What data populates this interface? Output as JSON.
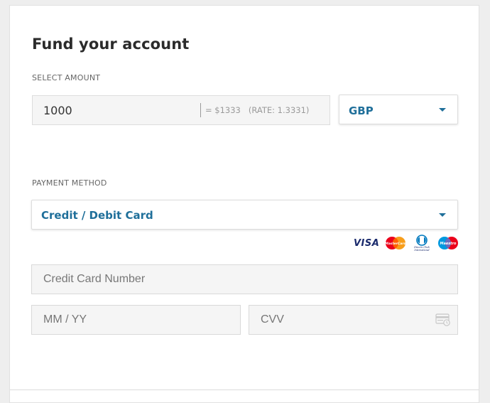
{
  "page": {
    "title": "Fund your account"
  },
  "amount": {
    "section_label": "SELECT AMOUNT",
    "value": "1000",
    "converted": "= $1333",
    "rate": "(RATE: 1.3331)",
    "currency": "GBP"
  },
  "payment": {
    "section_label": "PAYMENT METHOD",
    "method": "Credit / Debit Card",
    "accepted_cards": [
      "VISA",
      "MasterCard",
      "Diners Club International",
      "Maestro"
    ]
  },
  "card_form": {
    "number_placeholder": "Credit Card Number",
    "expiry_placeholder": "MM / YY",
    "cvv_placeholder": "CVV"
  },
  "colors": {
    "accent": "#1f6f9a",
    "visa_blue": "#1a2a6c",
    "mastercard_red": "#eb001b",
    "mastercard_yellow": "#f79e1b",
    "maestro_blue": "#0099df",
    "diners_blue": "#0079be"
  },
  "icons": {
    "currency_dropdown": "chevron-down-icon",
    "method_dropdown": "chevron-down-icon",
    "cvv_field": "credit-card-cvv-icon"
  }
}
